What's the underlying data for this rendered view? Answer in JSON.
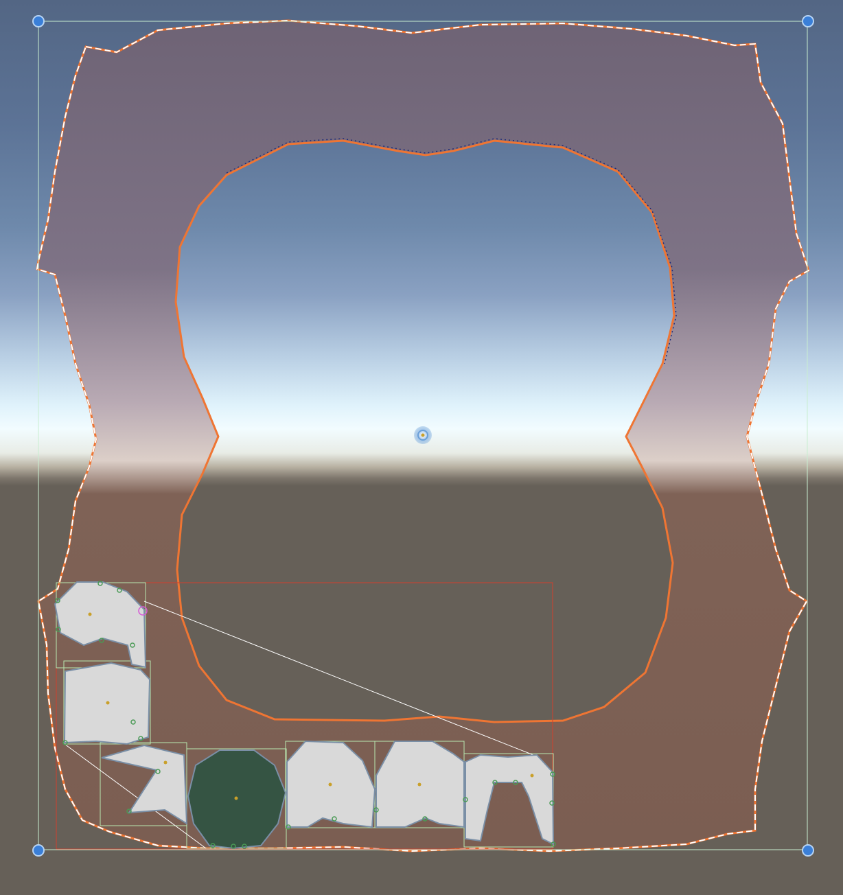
{
  "scene": {
    "title": "",
    "sky_colors": {
      "top": "#536684",
      "horizon": "#f2fcff",
      "ground": "#666058"
    },
    "shape_fill": "#7b5e55",
    "outline_color": "#ef7533",
    "selection_outline": "#ffffff",
    "rect_tool_color": "#b8e8b0",
    "pivot_color": "#6aa0d8",
    "handle_color": "#3a7fd8",
    "tile_fill": "#d9d9d9",
    "tile_border": "#7a8fa6",
    "selected_tile_fill": "#355443",
    "node_color": "#4a9a55",
    "center_point_color": "#c9a02a",
    "bounds_color": "#d0402e"
  },
  "handles": [
    {
      "name": "rect-handle-top-left"
    },
    {
      "name": "rect-handle-top-right"
    },
    {
      "name": "rect-handle-bottom-left"
    },
    {
      "name": "rect-handle-bottom-right"
    }
  ],
  "tiles": [
    {
      "name": "tile-1",
      "selected": false
    },
    {
      "name": "tile-2",
      "selected": false
    },
    {
      "name": "tile-3",
      "selected": false
    },
    {
      "name": "tile-4",
      "selected": true
    },
    {
      "name": "tile-5",
      "selected": false
    },
    {
      "name": "tile-6",
      "selected": false
    },
    {
      "name": "tile-7",
      "selected": false
    }
  ],
  "tool_icons": {
    "pivot": "pivot-icon",
    "vertex_cursor": "vertex-cursor-icon"
  }
}
